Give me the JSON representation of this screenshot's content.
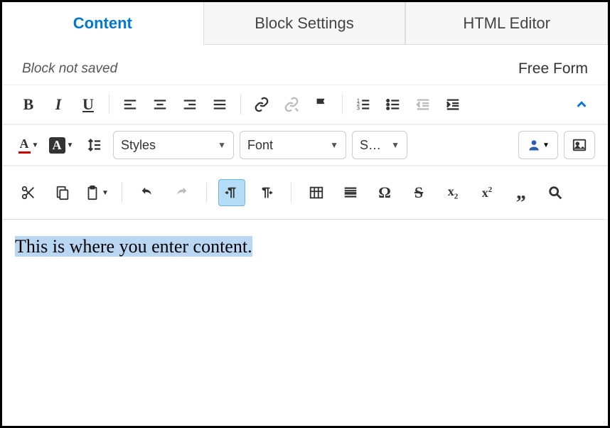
{
  "tabs": {
    "content": "Content",
    "block_settings": "Block Settings",
    "html_editor": "HTML Editor"
  },
  "status": {
    "not_saved": "Block not saved",
    "free_form": "Free Form"
  },
  "dropdowns": {
    "styles": "Styles",
    "font": "Font",
    "size": "S…"
  },
  "editor": {
    "body_text": "This is where you enter content."
  }
}
